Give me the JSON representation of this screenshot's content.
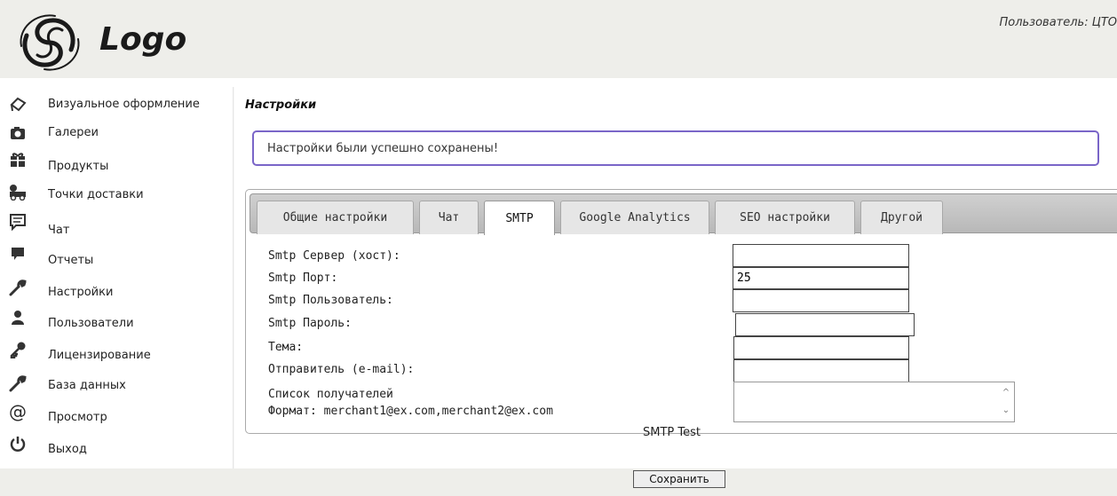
{
  "header": {
    "logo_text": "Logo",
    "user_info": "Пользователь: ЦТО"
  },
  "sidebar": {
    "items": [
      {
        "label": "Визуальное оформление",
        "icon": "palette-icon"
      },
      {
        "label": "Галереи",
        "icon": "camera-icon"
      },
      {
        "label": "Продукты",
        "icon": "gift-icon"
      },
      {
        "label": "Точки доставки",
        "icon": "delivery-truck-icon"
      },
      {
        "label": "Чат",
        "icon": "chat-icon"
      },
      {
        "label": "Отчеты",
        "icon": "comment-icon"
      },
      {
        "label": "Настройки",
        "icon": "wrench-icon"
      },
      {
        "label": "Пользователи",
        "icon": "user-icon"
      },
      {
        "label": "Лицензирование",
        "icon": "key-icon"
      },
      {
        "label": "База данных",
        "icon": "wrench-icon"
      },
      {
        "label": "Просмотр",
        "icon": "at-icon"
      },
      {
        "label": "Выход",
        "icon": "power-icon"
      }
    ]
  },
  "main": {
    "title": "Настройки",
    "notice": "Настройки были успешно сохранены!",
    "tabs": [
      {
        "label": "Общие настройки"
      },
      {
        "label": "Чат"
      },
      {
        "label": "SMTP",
        "active": true
      },
      {
        "label": "Google Analytics"
      },
      {
        "label": "SEO настройки"
      },
      {
        "label": "Другой"
      }
    ],
    "form": {
      "server_label": "Smtp Сервер (хост):",
      "server_value": "",
      "port_label": "Smtp Порт:",
      "port_value": "25",
      "user_label": "Smtp Пользователь:",
      "user_value": "",
      "password_label": "Smtp Пароль:",
      "password_value": "",
      "subject_label": "Тема:",
      "subject_value": "",
      "sender_label": "Отправитель (e-mail):",
      "sender_value": "",
      "recipients_label": "Список получателей",
      "recipients_format": "Формат: merchant1@ex.com,merchant2@ex.com",
      "recipients_value": "",
      "smtp_test": "SMTP Test"
    },
    "save_label": "Сохранить"
  }
}
